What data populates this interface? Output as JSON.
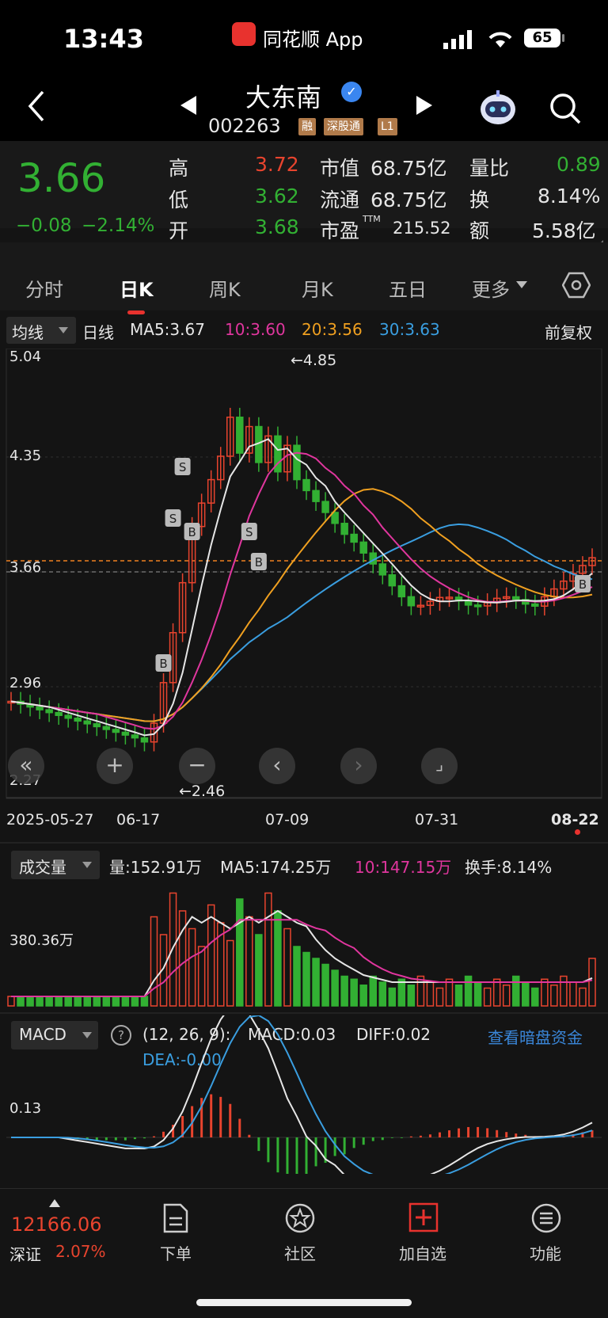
{
  "status_bar": {
    "time": "13:43",
    "app_name": "同花顺 App",
    "battery": "65"
  },
  "nav": {
    "stock_name": "大东南",
    "stock_code": "002263",
    "tags": [
      "融",
      "深股通",
      "L1"
    ]
  },
  "quote": {
    "price": "3.66",
    "change": "−0.08",
    "change_pct": "−2.14%",
    "high_label": "高",
    "high": "3.72",
    "low_label": "低",
    "low": "3.62",
    "open_label": "开",
    "open": "3.68",
    "mcap_label": "市值",
    "mcap": "68.75亿",
    "float_label": "流通",
    "float": "68.75亿",
    "pe_label": "市盈",
    "pe_sup": "TTM",
    "pe": "215.52",
    "vr_label": "量比",
    "vr": "0.89",
    "turnover_label": "换",
    "turnover": "8.14%",
    "amount_label": "额",
    "amount": "5.58亿"
  },
  "tabs": [
    "分时",
    "日K",
    "周K",
    "月K",
    "五日",
    "更多"
  ],
  "kline": {
    "indicator_dropdown": "均线",
    "period": "日线",
    "ma5": "MA5:3.67",
    "ma10": "10:3.60",
    "ma20": "20:3.56",
    "ma30": "30:3.63",
    "adjust": "前复权",
    "y_ticks": [
      "5.04",
      "4.35",
      "3.66",
      "2.96",
      "2.27"
    ],
    "max_label": "←4.85",
    "min_label": "←2.46",
    "x_labels": [
      "2025-05-27",
      "06-17",
      "07-09",
      "07-31",
      "08-22"
    ],
    "markers": [
      "S",
      "S",
      "B",
      "B",
      "S",
      "B",
      "B"
    ],
    "colors": {
      "up": "#e8442e",
      "down": "#32b033",
      "ma5": "#e6e6e6",
      "ma10": "#e0369e",
      "ma20": "#f0a020",
      "ma30": "#3a9ee0"
    }
  },
  "volume": {
    "dropdown": "成交量",
    "vol": "量:152.91万",
    "ma5": "MA5:174.25万",
    "ma10": "10:147.15万",
    "turnover": "换手:8.14%",
    "y_tick": "380.36万"
  },
  "macd": {
    "dropdown": "MACD",
    "help": "?",
    "params": "(12, 26, 9):",
    "macd": "MACD:0.03",
    "diff": "DIFF:0.02",
    "dea": "DEA:-0.00",
    "link": "查看暗盘资金",
    "y_tick": "0.13"
  },
  "bottom": {
    "index_value": "12166.06",
    "index_name": "深证",
    "index_pct": "2.07%",
    "items": [
      "下单",
      "社区",
      "加自选",
      "功能"
    ]
  }
}
